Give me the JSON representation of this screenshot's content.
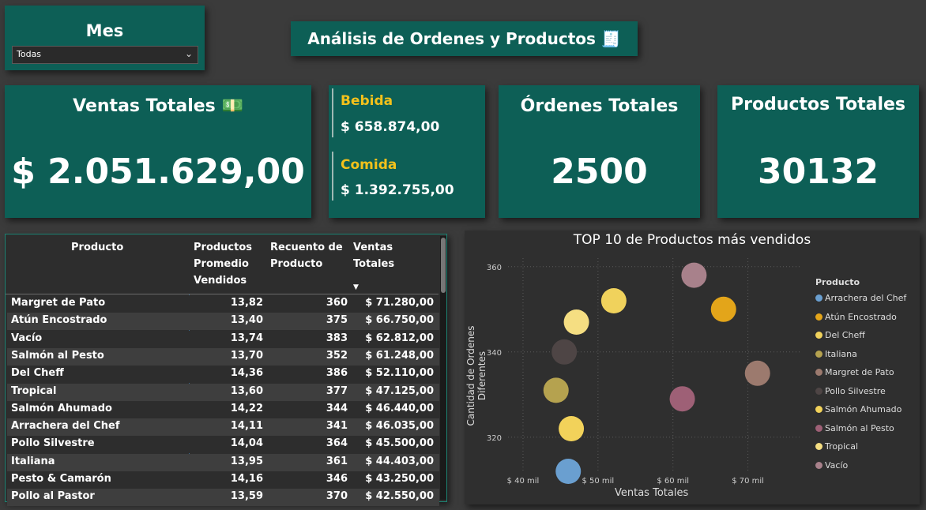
{
  "filter": {
    "title": "Mes",
    "selected": "Todas"
  },
  "header": {
    "title": "Análisis de Ordenes y Productos 🧾"
  },
  "kpis": {
    "ventas_label": "Ventas Totales 💵",
    "ventas_value": "$ 2.051.629,00",
    "bebida_label": "Bebida",
    "bebida_value": "$ 658.874,00",
    "comida_label": "Comida",
    "comida_value": "$ 1.392.755,00",
    "ordenes_label": "Órdenes Totales",
    "ordenes_value": "2500",
    "productos_label": "Productos Totales",
    "productos_value": "30132"
  },
  "table": {
    "headers": {
      "producto": "Producto",
      "promedio": "Productos Promedio Vendidos",
      "recuento": "Recuento de Producto",
      "ventas": "Ventas Totales"
    },
    "rows": [
      [
        "Margret de Pato",
        "13,82",
        "360",
        "$ 71.280,00"
      ],
      [
        "Atún Encostrado",
        "13,40",
        "375",
        "$ 66.750,00"
      ],
      [
        "Vacío",
        "13,74",
        "383",
        "$ 62.812,00"
      ],
      [
        "Salmón al Pesto",
        "13,70",
        "352",
        "$ 61.248,00"
      ],
      [
        "Del Cheff",
        "14,36",
        "386",
        "$ 52.110,00"
      ],
      [
        "Tropical",
        "13,60",
        "377",
        "$ 47.125,00"
      ],
      [
        "Salmón Ahumado",
        "14,22",
        "344",
        "$ 46.440,00"
      ],
      [
        "Arrachera del Chef",
        "14,11",
        "341",
        "$ 46.035,00"
      ],
      [
        "Pollo Silvestre",
        "14,04",
        "364",
        "$ 45.500,00"
      ],
      [
        "Italiana",
        "13,95",
        "361",
        "$ 44.403,00"
      ],
      [
        "Pesto & Camarón",
        "14,16",
        "346",
        "$ 43.250,00"
      ],
      [
        "Pollo al Pastor",
        "13,59",
        "370",
        "$ 42.550,00"
      ]
    ]
  },
  "chart_data": {
    "type": "scatter",
    "title": "TOP 10 de Productos más vendidos",
    "xlabel": "Ventas Totales",
    "ylabel": "Cantidad de Ordenes Diferentes",
    "xlim": [
      38000,
      77000
    ],
    "ylim": [
      312,
      362
    ],
    "x_ticks": [
      40000,
      50000,
      60000,
      70000
    ],
    "x_tick_labels": [
      "$ 40 mil",
      "$ 50 mil",
      "$ 60 mil",
      "$ 70 mil"
    ],
    "y_ticks": [
      320,
      340,
      360
    ],
    "y_tick_labels": [
      "320",
      "340",
      "360"
    ],
    "legend_title": "Producto",
    "legend_position": "right",
    "grid": true,
    "points": [
      {
        "name": "Arrachera del Chef",
        "x": 46035,
        "y": 312,
        "color": "#6a9fd0"
      },
      {
        "name": "Atún Encostrado",
        "x": 66750,
        "y": 350,
        "color": "#e3a51a"
      },
      {
        "name": "Del Cheff",
        "x": 52110,
        "y": 352,
        "color": "#f0d25c"
      },
      {
        "name": "Italiana",
        "x": 44403,
        "y": 331,
        "color": "#b5a24f"
      },
      {
        "name": "Margret de Pato",
        "x": 71280,
        "y": 335,
        "color": "#9c7a6e"
      },
      {
        "name": "Pollo Silvestre",
        "x": 45500,
        "y": 340,
        "color": "#4e4545"
      },
      {
        "name": "Salmón Ahumado",
        "x": 46440,
        "y": 322,
        "color": "#f2d25a"
      },
      {
        "name": "Salmón al Pesto",
        "x": 61248,
        "y": 329,
        "color": "#9e6076"
      },
      {
        "name": "Tropical",
        "x": 47125,
        "y": 347,
        "color": "#f5de82"
      },
      {
        "name": "Vacío",
        "x": 62812,
        "y": 358,
        "color": "#a8818b"
      }
    ]
  }
}
